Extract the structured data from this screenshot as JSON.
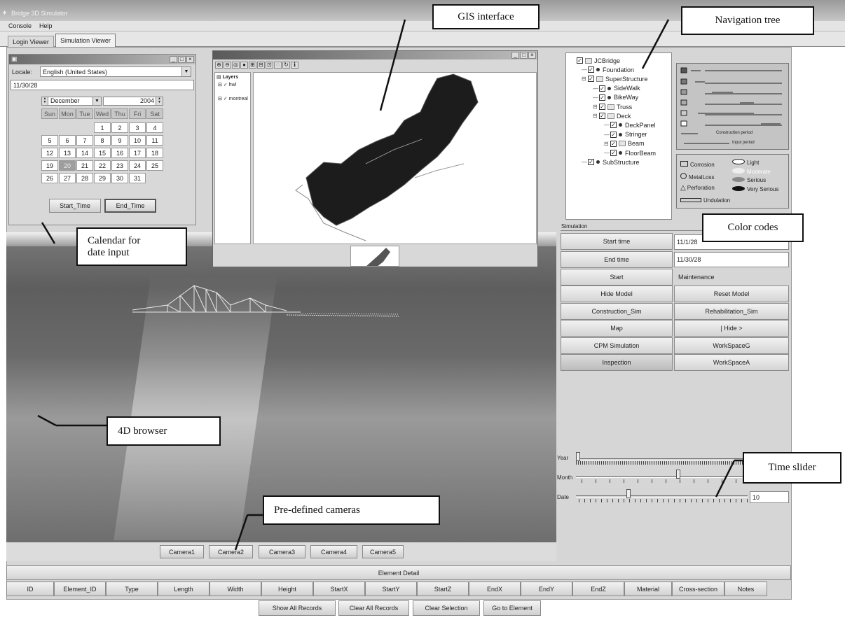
{
  "window": {
    "title": "Bridge 3D Simulator"
  },
  "menu": [
    "Console",
    "Help"
  ],
  "tabs": [
    "Login Viewer",
    "Simulation Viewer"
  ],
  "calendar": {
    "locale_label": "Locale:",
    "locale_value": "English (United States)",
    "date_value": "11/30/28",
    "month": "December",
    "year": "2004",
    "weekdays": [
      "Sun",
      "Mon",
      "Tue",
      "Wed",
      "Thu",
      "Fri",
      "Sat"
    ],
    "weeks": [
      [
        "",
        "",
        "",
        "1",
        "2",
        "3",
        "4"
      ],
      [
        "5",
        "6",
        "7",
        "8",
        "9",
        "10",
        "11"
      ],
      [
        "12",
        "13",
        "14",
        "15",
        "16",
        "17",
        "18"
      ],
      [
        "19",
        "20",
        "21",
        "22",
        "23",
        "24",
        "25"
      ],
      [
        "26",
        "27",
        "28",
        "29",
        "30",
        "31",
        ""
      ]
    ],
    "selected_day": "20",
    "start_button": "Start_Time",
    "end_button": "End_Time"
  },
  "gis": {
    "layers_root": "Layers",
    "layers": [
      "hwl",
      "montreal"
    ]
  },
  "nav_tree": {
    "nodes": [
      {
        "label": "JCBridge",
        "depth": 0,
        "kind": "folder"
      },
      {
        "label": "Foundation",
        "depth": 1,
        "kind": "leaf"
      },
      {
        "label": "SuperStructure",
        "depth": 1,
        "kind": "folder"
      },
      {
        "label": "SideWalk",
        "depth": 2,
        "kind": "leaf"
      },
      {
        "label": "BikeWay",
        "depth": 2,
        "kind": "leaf"
      },
      {
        "label": "Truss",
        "depth": 2,
        "kind": "folder"
      },
      {
        "label": "Deck",
        "depth": 2,
        "kind": "folder"
      },
      {
        "label": "DeckPanel",
        "depth": 3,
        "kind": "leaf"
      },
      {
        "label": "Stringer",
        "depth": 3,
        "kind": "leaf"
      },
      {
        "label": "Beam",
        "depth": 3,
        "kind": "folder"
      },
      {
        "label": "FloorBeam",
        "depth": 3,
        "kind": "leaf"
      },
      {
        "label": "SubStructure",
        "depth": 1,
        "kind": "leaf"
      }
    ]
  },
  "legend_periods": {
    "construction_period": "Construction period",
    "input_period": "Input period"
  },
  "legend_defects": {
    "shapes": [
      "Corrosion",
      "MetalLoss",
      "Perforation",
      "Undulation"
    ],
    "severity": [
      "Light",
      "Moderate",
      "Serious",
      "Very Serious"
    ]
  },
  "simulation": {
    "label": "Simulation",
    "start_time_label": "Start time",
    "start_time_value": "11/1/28",
    "end_time_label": "End time",
    "end_time_value": "11/30/28",
    "start_label": "Start",
    "start_value": "Maintenance",
    "rows": [
      [
        "Hide Model",
        "Reset Model"
      ],
      [
        "Construction_Sim",
        "Rehabilitation_Sim"
      ],
      [
        "Map",
        "| Hide >"
      ],
      [
        "CPM Simulation",
        "WorkSpaceG"
      ],
      [
        "Inspection",
        "WorkSpaceA"
      ]
    ]
  },
  "sliders": {
    "year_label": "Year",
    "month_label": "Month",
    "date_label": "Date",
    "date_value": "10",
    "year_fraction": 0.0,
    "month_fraction": 0.6,
    "date_fraction": 0.3
  },
  "cameras": [
    "Camera1",
    "Camera2",
    "Camera3",
    "Camera4",
    "Camera5"
  ],
  "element_detail": {
    "title": "Element Detail",
    "columns": [
      "ID",
      "Element_ID",
      "Type",
      "Length",
      "Width",
      "Height",
      "StartX",
      "StartY",
      "StartZ",
      "EndX",
      "EndY",
      "EndZ",
      "Material",
      "Cross-section",
      "Notes"
    ]
  },
  "actions": [
    "Show All Records",
    "Clear All Records",
    "Clear Selection",
    "Go to Element"
  ],
  "callouts": {
    "gis": "GIS interface",
    "nav": "Navigation tree",
    "calendar": "Calendar for date input",
    "color": "Color codes",
    "browser": "4D browser",
    "time": "Time slider",
    "cameras": "Pre-defined cameras"
  }
}
